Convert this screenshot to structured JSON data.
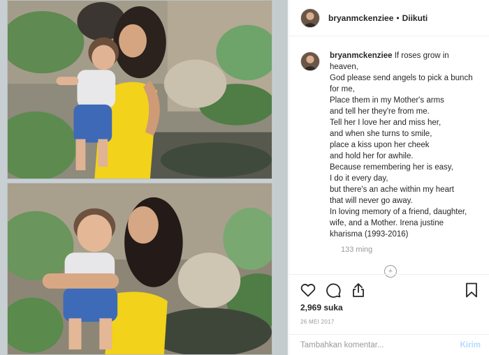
{
  "header": {
    "username": "bryanmckenziee",
    "separator": "•",
    "follow_status": "Diikuti"
  },
  "caption": {
    "username": "bryanmckenziee",
    "text": "If roses grow in heaven,\nGod please send angels to pick a bunch for me,\nPlace them in my Mother's arms\nand tell her they're from me.\nTell her I love her and miss her,\nand when she turns to smile,\nplace a kiss upon her cheek\nand hold her for awhile.\nBecause remembering her is easy,\nI do it every day,\nbut there's an ache within my heart\nthat will never go away.\nIn loving memory of a friend, daughter, wife, and a Mother. Irena justine kharisma (1993-2016)",
    "time": "133 ming"
  },
  "load_more_icon": "+",
  "actions": {
    "like_icon": "heart-outline-icon",
    "comment_icon": "speech-bubble-icon",
    "share_icon": "share-upload-icon",
    "save_icon": "bookmark-icon"
  },
  "likes": "2,969 suka",
  "date": "26 MEI 2017",
  "comment_box": {
    "placeholder": "Tambahkan komentar...",
    "post_label": "Kirim"
  },
  "colors": {
    "text": "#262626",
    "muted": "#999999",
    "border": "#efefef",
    "post_disabled": "#b3dbff",
    "dress_yellow": "#f2d21a"
  }
}
